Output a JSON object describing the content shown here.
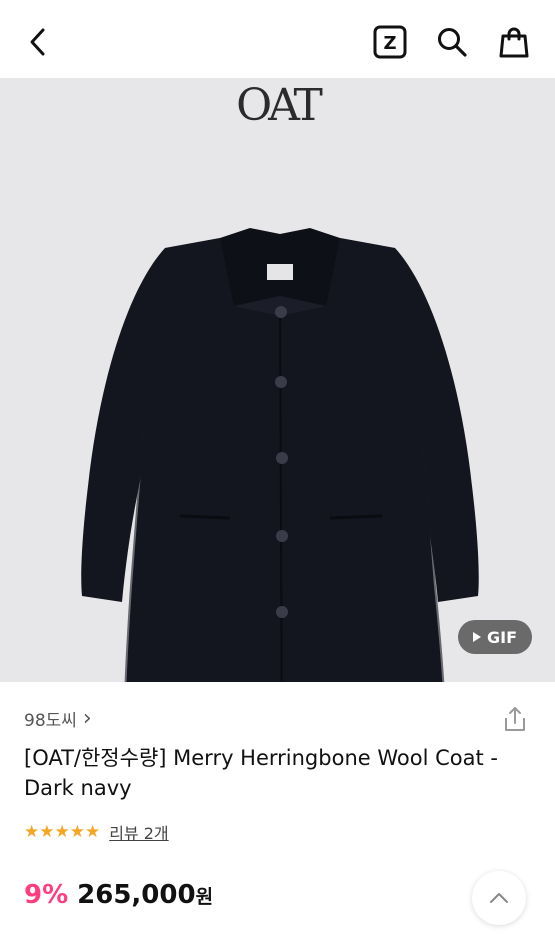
{
  "header": {
    "back_icon": "chevron-left-icon",
    "z_icon_letter": "Z",
    "search_icon": "search-icon",
    "bag_icon": "shopping-bag-icon"
  },
  "hero": {
    "brand_logo": "OAT",
    "gif_label": "GIF"
  },
  "product": {
    "seller": "98도씨",
    "seller_chevron": "›",
    "title": "[OAT/한정수량] Merry Herringbone Wool Coat - Dark navy",
    "rating": {
      "stars": 5,
      "stars_text": "★★★★★",
      "review_link": "리뷰 2개"
    },
    "discount": "9%",
    "price": "265,000",
    "currency": "원"
  },
  "colors": {
    "discount": "#ff3d7f",
    "star": "#f5a623",
    "hero_bg": "#e7e7e9",
    "coat": "#14161f"
  }
}
